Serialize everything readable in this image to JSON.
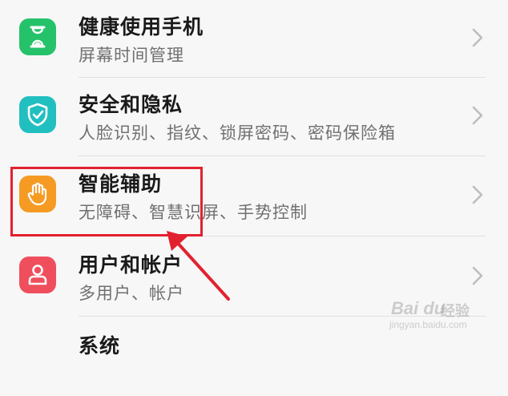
{
  "settings": {
    "items": [
      {
        "title": "健康使用手机",
        "subtitle": "屏幕时间管理",
        "icon": "hourglass-icon",
        "color": "#25c26a"
      },
      {
        "title": "安全和隐私",
        "subtitle": "人脸识别、指纹、锁屏密码、密码保险箱",
        "icon": "shield-check-icon",
        "color": "#22bfc0"
      },
      {
        "title": "智能辅助",
        "subtitle": "无障碍、智慧识屏、手势控制",
        "icon": "hand-icon",
        "color": "#f59b24"
      },
      {
        "title": "用户和帐户",
        "subtitle": "多用户、帐户",
        "icon": "user-icon",
        "color": "#ef4f5d"
      },
      {
        "title": "系统",
        "subtitle": "",
        "icon": "",
        "color": ""
      }
    ]
  },
  "annotation": {
    "highlight_color": "#e2212f"
  },
  "watermark": {
    "logo": "Bai du",
    "name": "经验",
    "url": "jingyan.baidu.com"
  }
}
